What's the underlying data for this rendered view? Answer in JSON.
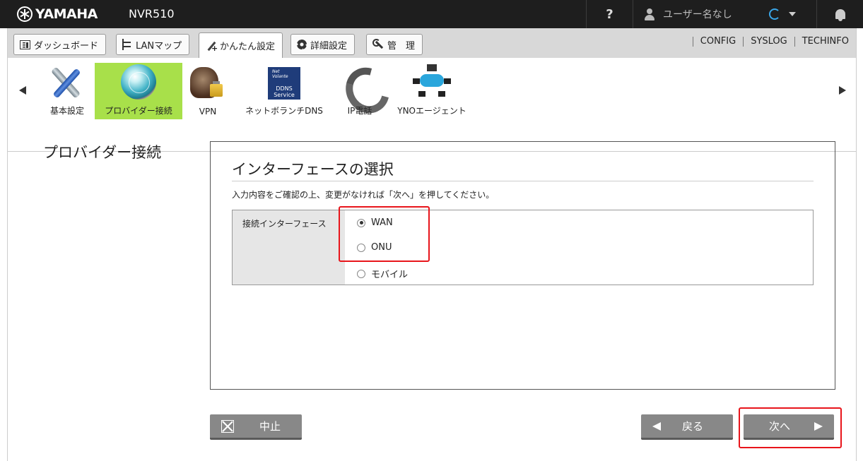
{
  "header": {
    "brand": "YAMAHA",
    "model": "NVR510",
    "help_label": "?",
    "user_name": "ユーザー名なし"
  },
  "tabs": [
    {
      "label": "ダッシュボード",
      "icon": "dashboard-icon"
    },
    {
      "label": "LANマップ",
      "icon": "lan-map-icon"
    },
    {
      "label": "かんたん設定",
      "icon": "magic-wand-icon",
      "active": true
    },
    {
      "label": "詳細設定",
      "icon": "gear-icon"
    },
    {
      "label": "管　理",
      "icon": "wrench-icon"
    }
  ],
  "right_links": [
    "CONFIG",
    "SYSLOG",
    "TECHINFO"
  ],
  "tools": [
    {
      "label": "基本設定",
      "icon": "tools-icon"
    },
    {
      "label": "プロバイダー接続",
      "icon": "globe-icon",
      "selected": true
    },
    {
      "label": "VPN",
      "icon": "vpn-lock-icon"
    },
    {
      "label": "ネットボランチDNS",
      "icon": "ddns-service-icon"
    },
    {
      "label": "IP電話",
      "icon": "telephone-icon"
    },
    {
      "label": "YNOエージェント",
      "icon": "network-cloud-icon"
    }
  ],
  "ddns_icon_text": {
    "line1": "Net",
    "line2": "Volante",
    "line3": "DDNS",
    "line4": "Service"
  },
  "section_title": "プロバイダー接続",
  "panel": {
    "title": "インターフェースの選択",
    "description": "入力内容をご確認の上、変更がなければ「次へ」を押してください。",
    "field_label": "接続インターフェース",
    "options": [
      {
        "label": "WAN",
        "checked": true
      },
      {
        "label": "ONU",
        "checked": false
      },
      {
        "label": "モバイル",
        "checked": false
      }
    ]
  },
  "buttons": {
    "cancel": "中止",
    "back": "戻る",
    "next": "次へ"
  },
  "colors": {
    "topbar": "#1e1e1e",
    "selected_tool": "#a8e04a",
    "button": "#888888",
    "highlight": "#e8151b"
  }
}
